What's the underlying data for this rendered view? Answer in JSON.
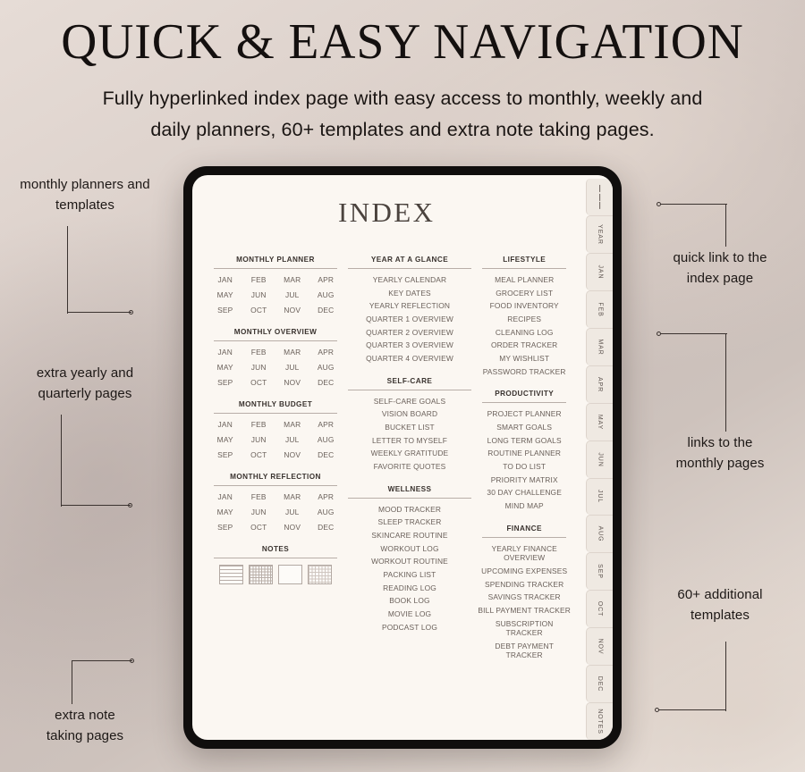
{
  "header": {
    "headline": "QUICK & EASY NAVIGATION",
    "subline_1": "Fully hyperlinked index page with easy access to monthly, weekly and",
    "subline_2": "daily planners, 60+ templates and extra note taking pages."
  },
  "device": {
    "page_title": "INDEX",
    "tabs": [
      {
        "label": "",
        "icon": "hamburger-menu-icon"
      },
      {
        "label": "YEAR",
        "icon": ""
      },
      {
        "label": "JAN",
        "icon": ""
      },
      {
        "label": "FEB",
        "icon": ""
      },
      {
        "label": "MAR",
        "icon": ""
      },
      {
        "label": "APR",
        "icon": ""
      },
      {
        "label": "MAY",
        "icon": ""
      },
      {
        "label": "JUN",
        "icon": ""
      },
      {
        "label": "JUL",
        "icon": ""
      },
      {
        "label": "AUG",
        "icon": ""
      },
      {
        "label": "SEP",
        "icon": ""
      },
      {
        "label": "OCT",
        "icon": ""
      },
      {
        "label": "NOV",
        "icon": ""
      },
      {
        "label": "DEC",
        "icon": ""
      },
      {
        "label": "NOTES",
        "icon": ""
      }
    ]
  },
  "months": [
    "JAN",
    "FEB",
    "MAR",
    "APR",
    "MAY",
    "JUN",
    "JUL",
    "AUG",
    "SEP",
    "OCT",
    "NOV",
    "DEC"
  ],
  "index": {
    "column_left": [
      {
        "title": "MONTHLY PLANNER",
        "type": "months"
      },
      {
        "title": "MONTHLY OVERVIEW",
        "type": "months"
      },
      {
        "title": "MONTHLY BUDGET",
        "type": "months"
      },
      {
        "title": "MONTHLY REFLECTION",
        "type": "months"
      },
      {
        "title": "NOTES",
        "type": "papers",
        "papers": [
          "lined-paper-icon",
          "grid-paper-icon",
          "blank-paper-icon",
          "dotted-paper-icon"
        ]
      }
    ],
    "column_middle": [
      {
        "title": "YEAR AT A GLANCE",
        "type": "links",
        "items": [
          "YEARLY CALENDAR",
          "KEY DATES",
          "YEARLY REFLECTION",
          "QUARTER 1 OVERVIEW",
          "QUARTER 2 OVERVIEW",
          "QUARTER 3 OVERVIEW",
          "QUARTER 4 OVERVIEW"
        ]
      },
      {
        "title": "SELF-CARE",
        "type": "links",
        "items": [
          "SELF-CARE GOALS",
          "VISION BOARD",
          "BUCKET LIST",
          "LETTER TO MYSELF",
          "WEEKLY GRATITUDE",
          "FAVORITE QUOTES"
        ]
      },
      {
        "title": "WELLNESS",
        "type": "links",
        "items": [
          "MOOD TRACKER",
          "SLEEP TRACKER",
          "SKINCARE ROUTINE",
          "WORKOUT LOG",
          "WORKOUT ROUTINE",
          "PACKING LIST",
          "READING LOG",
          "BOOK LOG",
          "MOVIE LOG",
          "PODCAST LOG"
        ]
      }
    ],
    "column_right": [
      {
        "title": "LIFESTYLE",
        "type": "links",
        "items": [
          "MEAL PLANNER",
          "GROCERY LIST",
          "FOOD INVENTORY",
          "RECIPES",
          "CLEANING LOG",
          "ORDER TRACKER",
          "MY WISHLIST",
          "PASSWORD TRACKER"
        ]
      },
      {
        "title": "PRODUCTIVITY",
        "type": "links",
        "items": [
          "PROJECT PLANNER",
          "SMART GOALS",
          "LONG TERM GOALS",
          "ROUTINE PLANNER",
          "TO DO LIST",
          "PRIORITY MATRIX",
          "30 DAY CHALLENGE",
          "MIND MAP"
        ]
      },
      {
        "title": "FINANCE",
        "type": "links",
        "items": [
          "YEARLY FINANCE OVERVIEW",
          "UPCOMING EXPENSES",
          "SPENDING TRACKER",
          "SAVINGS TRACKER",
          "BILL PAYMENT TRACKER",
          "SUBSCRIPTION TRACKER",
          "DEBT PAYMENT TRACKER"
        ]
      }
    ]
  },
  "callouts": {
    "left_top": {
      "line1": "monthly planners and",
      "line2": "templates"
    },
    "left_mid": {
      "line1": "extra yearly and",
      "line2": "quarterly pages"
    },
    "left_bottom": {
      "line1": "extra note",
      "line2": "taking pages"
    },
    "right_top": {
      "line1": "quick link to the",
      "line2": "index page"
    },
    "right_mid": {
      "line1": "links to the",
      "line2": "monthly pages"
    },
    "right_bottom": {
      "line1": "60+ additional",
      "line2": "templates"
    }
  },
  "colors": {
    "ink": "#14100f",
    "paper": "#fbf7f2",
    "device_frame": "#100e0d",
    "muted_text": "#6a605a",
    "rule": "#b8aea8",
    "tab_face": "#efe9e2"
  }
}
